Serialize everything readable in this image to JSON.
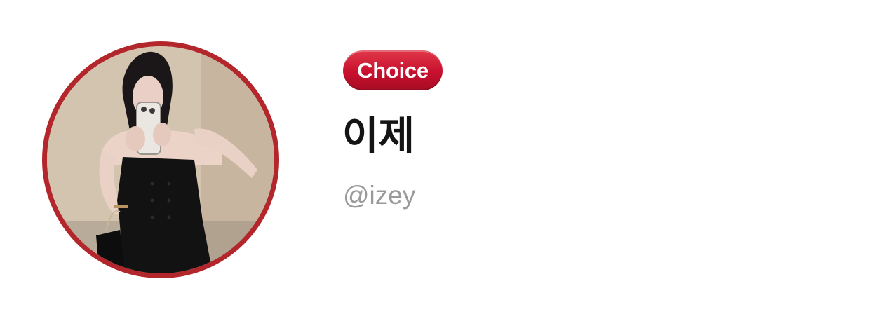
{
  "profile": {
    "badge_label": "Choice",
    "display_name": "이제",
    "handle": "@izey"
  },
  "colors": {
    "accent": "#c8102e",
    "avatar_ring": "#b3262b",
    "name_text": "#141414",
    "handle_text": "#9a9a9a"
  }
}
